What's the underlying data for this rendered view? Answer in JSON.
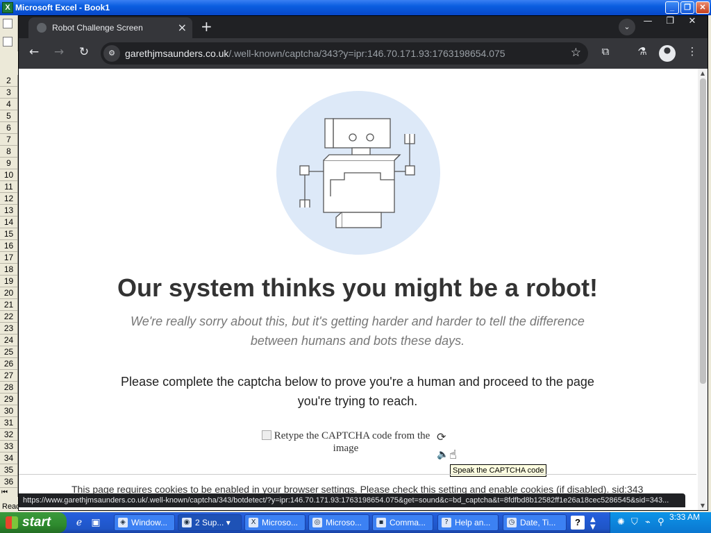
{
  "excel": {
    "title": "Microsoft Excel - Book1",
    "app_icon": "X",
    "rows": [
      "2",
      "3",
      "4",
      "5",
      "6",
      "7",
      "8",
      "9",
      "10",
      "11",
      "12",
      "13",
      "14",
      "15",
      "16",
      "17",
      "18",
      "19",
      "20",
      "21",
      "22",
      "23",
      "24",
      "25",
      "26",
      "27",
      "28",
      "29",
      "30",
      "31",
      "32",
      "33",
      "34",
      "35",
      "36"
    ],
    "status": "Ready"
  },
  "browser": {
    "tab_title": "Robot Challenge Screen",
    "url_host": "garethjmsaunders.co.uk",
    "url_path": "/.well-known/captcha/343?y=ipr:146.70.171.93:1763198654.075"
  },
  "page": {
    "headline": "Our system thinks you might be a robot!",
    "sorry_text": "We're really sorry about this, but it's getting harder and harder to tell the difference between humans and bots these days.",
    "instruction": "Please complete the captcha below to prove you're a human and proceed to the page you're trying to reach.",
    "captcha_alt": "Retype the CAPTCHA code from the image",
    "tooltip": "Speak the CAPTCHA code",
    "cookies_note": "This page requires cookies to be enabled in your browser settings. Please check this setting and enable cookies (if disabled). sid:343",
    "status_url": "https://www.garethjmsaunders.co.uk/.well-known/captcha/343/botdetect/?y=ipr:146.70.171.93:1763198654.075&get=sound&c=bd_captcha&t=8fdfbd8b12582ff1e26a18cec5286545&sid=343..."
  },
  "taskbar": {
    "start_label": "start",
    "tasks": [
      {
        "label": "Window..."
      },
      {
        "label": "2 Sup..."
      },
      {
        "label": "Microso..."
      },
      {
        "label": "Microso..."
      },
      {
        "label": "Comma..."
      },
      {
        "label": "Help an..."
      },
      {
        "label": "Date, Ti..."
      }
    ],
    "clock": "3:33 AM"
  },
  "icons": {
    "back": "back-arrow-icon",
    "forward": "forward-arrow-icon",
    "reload": "reload-icon",
    "site_info": "site-info-icon",
    "bookmark": "star-icon",
    "extensions": "puzzle-icon",
    "labs": "flask-icon",
    "profile": "profile-icon",
    "menu": "kebab-menu-icon",
    "captcha_reload": "captcha-reload-icon",
    "captcha_speak": "speaker-icon"
  },
  "colors": {
    "robot_circle": "#dde9f8",
    "chrome_frame": "#202124",
    "xp_taskbar": "#245edb"
  }
}
